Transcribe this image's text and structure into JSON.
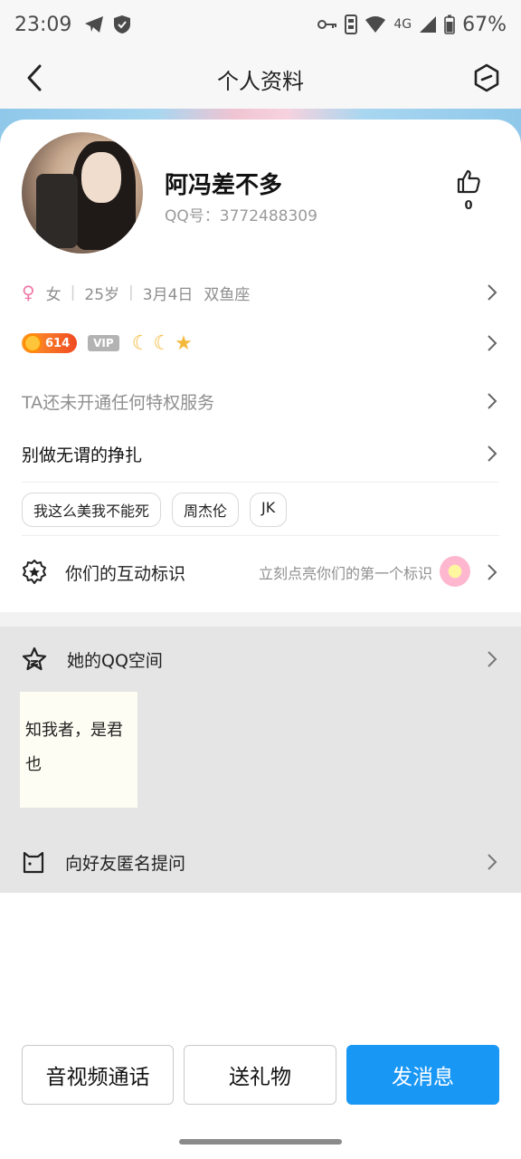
{
  "status_bar": {
    "time": "23:09",
    "network": "4G",
    "battery": "67%",
    "icons": [
      "telegram-icon",
      "shield-icon",
      "key-icon",
      "vibrate-icon",
      "wifi-icon",
      "signal-icon",
      "battery-icon"
    ]
  },
  "header": {
    "title": "个人资料",
    "back_icon": "chevron-left-icon",
    "more_icon": "hexagon-slash-icon"
  },
  "profile": {
    "name": "阿冯差不多",
    "qq_id": "QQ号：3772488309",
    "like_count": "0",
    "gender": "女",
    "age": "25岁",
    "birthday": "3月4日",
    "zodiac": "双鱼座",
    "level": "614",
    "vip_label": "VIP",
    "privilege_text": "TA还未开通任何特权服务",
    "signature": "别做无谓的挣扎",
    "tags": [
      "我这么美我不能死",
      "周杰伦",
      "JK"
    ]
  },
  "interaction": {
    "label": "你们的互动标识",
    "hint": "立刻点亮你们的第一个标识"
  },
  "qzone": {
    "label": "她的QQ空间",
    "post_text": "知我者，是君也"
  },
  "ask": {
    "label": "向好友匿名提问"
  },
  "buttons": {
    "call": "音视频通话",
    "gift": "送礼物",
    "message": "发消息"
  },
  "colors": {
    "accent": "#1997f5",
    "female": "#f07aa8",
    "grey_section": "#e5e5e5"
  }
}
